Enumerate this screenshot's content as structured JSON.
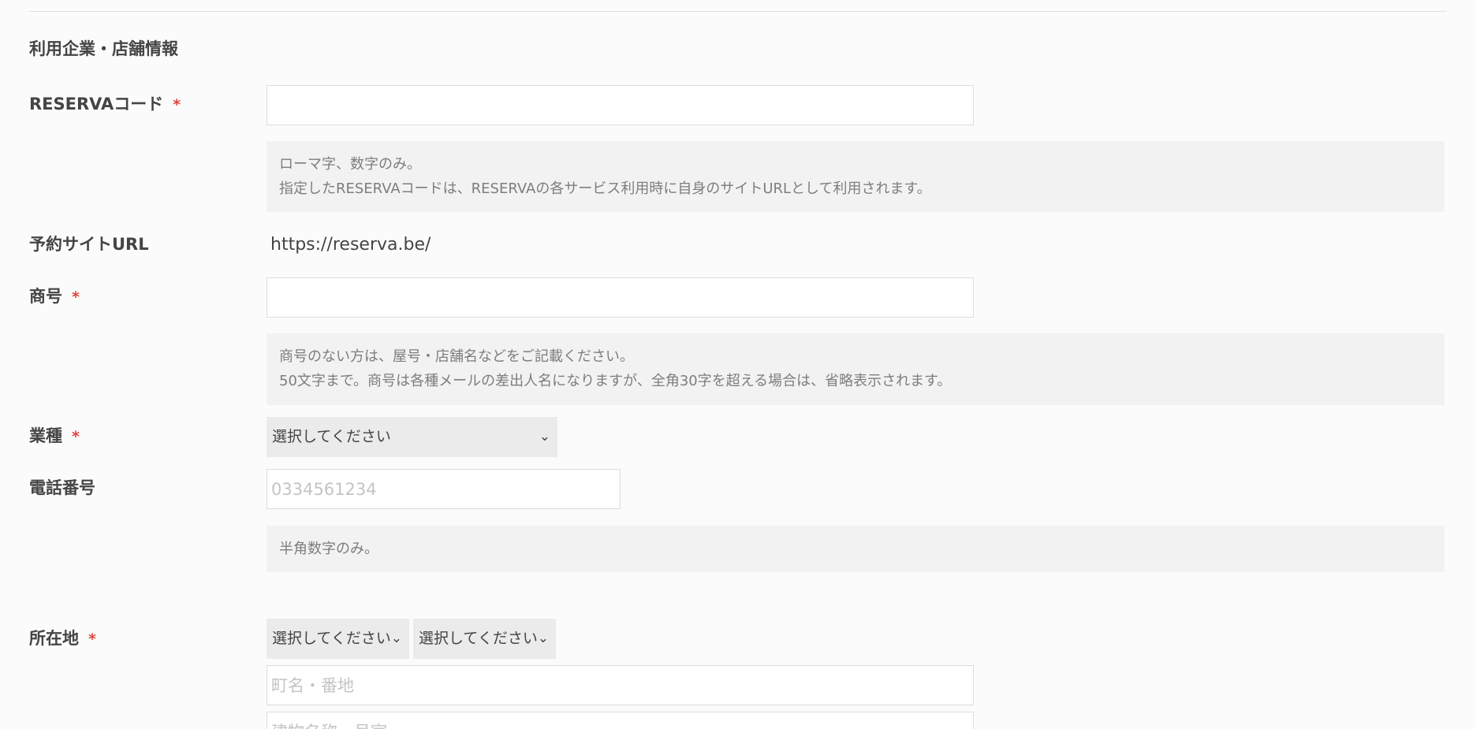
{
  "section": {
    "title": "利用企業・店舗情報"
  },
  "fields": {
    "reserva_code": {
      "label": "RESERVAコード",
      "required_mark": "*",
      "value": "",
      "help_lines": [
        "ローマ字、数字のみ。",
        "指定したRESERVAコードは、RESERVAの各サービス利用時に自身のサイトURLとして利用されます。"
      ]
    },
    "site_url": {
      "label": "予約サイトURL",
      "value": "https://reserva.be/"
    },
    "trade_name": {
      "label": "商号",
      "required_mark": "*",
      "value": "",
      "help_lines": [
        "商号のない方は、屋号・店舗名などをご記載ください。",
        "50文字まで。商号は各種メールの差出人名になりますが、全角30字を超える場合は、省略表示されます。"
      ]
    },
    "industry": {
      "label": "業種",
      "required_mark": "*",
      "selected": "選択してください"
    },
    "phone": {
      "label": "電話番号",
      "placeholder": "0334561234",
      "help_lines": [
        "半角数字のみ。"
      ]
    },
    "address": {
      "label": "所在地",
      "required_mark": "*",
      "prefecture_selected": "選択してください",
      "city_selected": "選択してください",
      "street_placeholder": "町名・番地",
      "building_placeholder": "建物名称・号室"
    }
  },
  "icons": {
    "dropdown": "chevron-down-icon"
  },
  "colors": {
    "required": "#e0443e",
    "help_bg": "#f2f2f2",
    "select_bg": "#ebebeb"
  }
}
